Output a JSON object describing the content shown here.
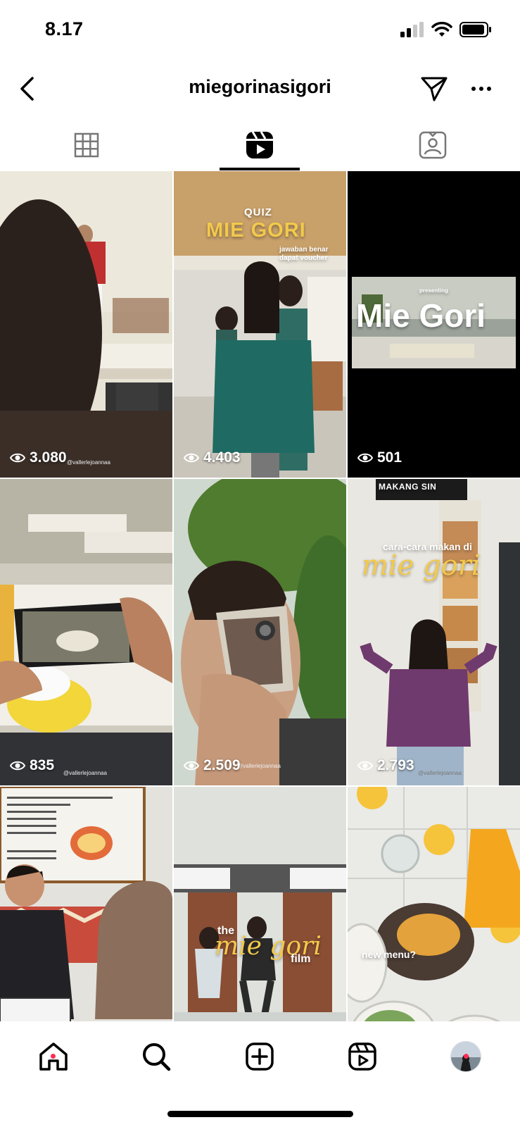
{
  "status": {
    "time": "8.17"
  },
  "header": {
    "username": "miegorinasigori"
  },
  "tabs": [
    {
      "icon": "grid-icon",
      "active": false
    },
    {
      "icon": "reels-icon",
      "active": true
    },
    {
      "icon": "tagged-icon",
      "active": false
    }
  ],
  "reels": [
    {
      "views": "3.080"
    },
    {
      "views": "4.403",
      "overlay_top": "QUIZ",
      "overlay_main": "MIE GORI",
      "overlay_sub": "jawaban benar dapat voucher"
    },
    {
      "views": "501",
      "overlay_top": "presenting",
      "overlay_main": "Mie Gori"
    },
    {
      "views": "835"
    },
    {
      "views": "2.509"
    },
    {
      "views": "2.793",
      "overlay_top": "cara-cara makan di",
      "overlay_main": "mie gori",
      "sign": "MAKANG SIN"
    },
    {
      "views": ""
    },
    {
      "views": "",
      "overlay_top": "the",
      "overlay_main": "mie gori",
      "overlay_sub": "film"
    },
    {
      "views": "",
      "overlay_top": "new menu?"
    }
  ],
  "watermarks": {
    "w1": "@vallerlejoannaa",
    "w5": "@vallerlejoannaa",
    "w4": "@vallerlejoannaa",
    "w6": "@vallerlejoannaa"
  },
  "nav": {
    "home": "home-icon",
    "search": "search-icon",
    "create": "create-icon",
    "reels": "reels-icon",
    "profile": "profile-avatar"
  },
  "colors": {
    "accent_yellow": "#f2c94c",
    "notification_dot": "#ff2d55"
  }
}
